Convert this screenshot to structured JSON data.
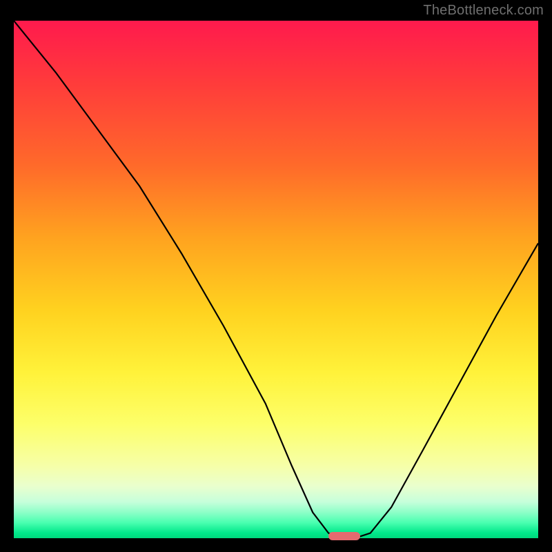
{
  "watermark": "TheBottleneck.com",
  "chart_data": {
    "type": "line",
    "title": "",
    "xlabel": "",
    "ylabel": "",
    "xlim": [
      0,
      100
    ],
    "ylim": [
      0,
      100
    ],
    "grid": false,
    "legend": false,
    "series": [
      {
        "name": "bottleneck-curve",
        "x": [
          0,
          8,
          16,
          24,
          32,
          40,
          48,
          53,
          57,
          60,
          62,
          65,
          68,
          72,
          78,
          85,
          92,
          100
        ],
        "values": [
          100,
          90,
          79,
          68,
          55,
          41,
          26,
          14,
          5,
          1,
          0,
          0,
          1,
          6,
          17,
          30,
          43,
          57
        ]
      }
    ],
    "marker": {
      "name": "optimal-range",
      "x_start": 60,
      "x_end": 66,
      "y": 0,
      "color": "#e46a6f"
    },
    "background_gradient": {
      "top": "#ff1a4d",
      "bottom": "#00d87d"
    }
  }
}
